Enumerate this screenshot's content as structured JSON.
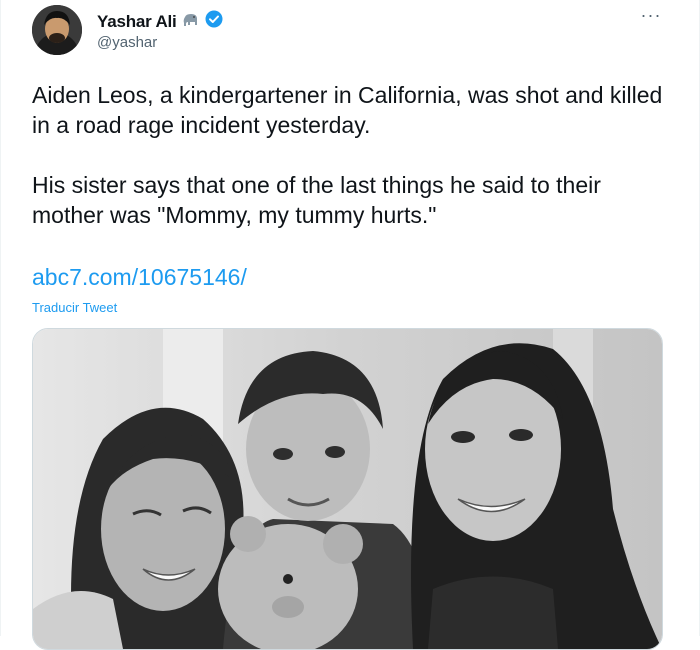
{
  "author": {
    "display_name": "Yashar Ali",
    "handle": "@yashar",
    "badge_icon": "elephant-emoji-icon",
    "verified_icon": "verified-badge-icon",
    "verified_color": "#1d9bf0"
  },
  "menu": {
    "icon": "more-options-icon"
  },
  "tweet": {
    "paragraphs": [
      "Aiden Leos, a kindergartener in California, was shot and killed in a road rage incident yesterday.",
      "His sister says that one of the last things he said to their mother was \"Mommy, my tummy hurts.\""
    ],
    "link": "abc7.com/10675146/",
    "translate_label": "Traducir Tweet"
  },
  "media": {
    "kind": "black-and-white photo",
    "subjects": [
      "woman-left",
      "child-with-teddy-bear",
      "young-woman-right"
    ]
  },
  "colors": {
    "text": "#0f1419",
    "secondary": "#536471",
    "link": "#1d9bf0"
  }
}
